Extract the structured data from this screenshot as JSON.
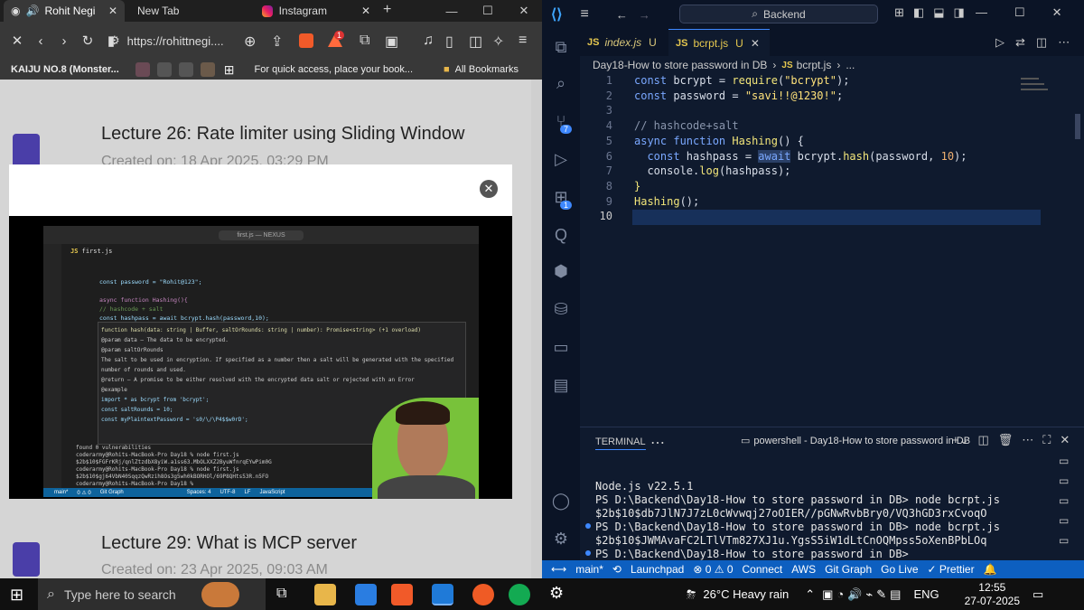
{
  "browser": {
    "tabs": [
      {
        "label": "Rohit Negi",
        "close": "✕"
      },
      {
        "label": "New Tab"
      },
      {
        "label": "Instagram"
      }
    ],
    "new_tab": "+",
    "url": "https://rohittnegi....",
    "shield_badge": "1",
    "bookmarks": [
      {
        "label": "KAIJU NO.8 (Monster..."
      }
    ],
    "bookmark_hint": "For quick access, place your book...",
    "all_bookmarks": "All Bookmarks",
    "lectures": [
      {
        "title": "Lecture 26: Rate limiter using Sliding Window",
        "date": "Created on: 18 Apr 2025, 03:29 PM"
      },
      {
        "title": "Lecture 29: What is MCP server",
        "date": "Created on: 23 Apr 2025, 09:03 AM"
      }
    ],
    "modal_close": "✕",
    "video": {
      "title_bar": "first.js — NEXUS",
      "tab": "first.js",
      "code": [
        "const password = \"Rohit@123\";",
        "async function Hashing(){",
        "// hashcode + salt",
        "const hashpass = await bcrypt.hash(password,10);"
      ],
      "hover": [
        "function hash(data: string | Buffer, saltOrRounds: string | number): Promise<string> (+1 overload)",
        "@param data — The data to be encrypted.",
        "@param saltOrRounds",
        "The salt to be used in encryption. If specified as a number then a salt will be generated with the specified number of rounds and used.",
        "@return — A promise to be either resolved with the encrypted data salt or rejected with an Error",
        "@example",
        "import * as bcrypt from 'bcrypt';",
        "const saltRounds = 10;",
        "const myPlaintextPassword = 's0/\\/\\P4$$w0rD';"
      ],
      "terminal": [
        "found 0 vulnerabilities",
        "coderarmy@Rohits-MacBook-Pro Day18 % node first.js",
        "$2b$10$FGFrKRj/qnlZtzdbX8yiW.a1ss63.MbOLXXZ2ByuWfnrqEYwPim0G",
        "coderarmy@Rohits-MacBook-Pro Day18 % node first.js",
        "$2b$10$gj64VbN40SqqzQwRzih8Os3g5wh0kBORHOl/69P8QHts53R.n5FO",
        "coderarmy@Rohits-MacBook-Pro Day18 % "
      ],
      "status": [
        "main*",
        "0 ⚠ 0",
        "Git Graph",
        "Spaces: 4",
        "UTF-8",
        "LF",
        "JavaScript"
      ]
    }
  },
  "vscode": {
    "search": "Backend",
    "tabs": [
      {
        "label": "index.js",
        "status": "U"
      },
      {
        "label": "bcrpt.js",
        "status": "U"
      }
    ],
    "breadcrumb": [
      "Day18-How to store password in DB",
      "bcrpt.js",
      "..."
    ],
    "code_lines": [
      "1",
      "2",
      "3",
      "4",
      "5",
      "6",
      "7",
      "8",
      "9",
      "10"
    ],
    "terminal_tab": "TERMINAL",
    "terminal_shell": "powershell - Day18-How to store password in DB",
    "terminal_lines": [
      "Node.js v22.5.1",
      "PS D:\\Backend\\Day18-How to store password in DB> node bcrpt.js",
      "$2b$10$db7JlN7J7zL0cWvwqj27oOIER//pGNwRvbBry0/VQ3hGD3rxCvoqO",
      "PS D:\\Backend\\Day18-How to store password in DB> node bcrpt.js",
      "$2b$10$JWMAvaFC2LTlVTm827XJ1u.YgsS5iW1dLtCnOQMpss5oXenBPbLOq",
      "PS D:\\Backend\\Day18-How to store password in DB> "
    ],
    "activity_badges": {
      "scm": "7",
      "ext": "1"
    },
    "status": {
      "branch": "main*",
      "problems": "⊗ 0 ⚠ 0",
      "launchpad": "Launchpad",
      "connect": "Connect",
      "aws": "AWS",
      "git_graph": "Git Graph",
      "go_live": "Go Live",
      "prettier": "✓ Prettier"
    }
  },
  "taskbar": {
    "search_placeholder": "Type here to search",
    "weather": "26°C  Heavy rain",
    "lang": "ENG",
    "time": "12:55",
    "date": "27-07-2025"
  }
}
